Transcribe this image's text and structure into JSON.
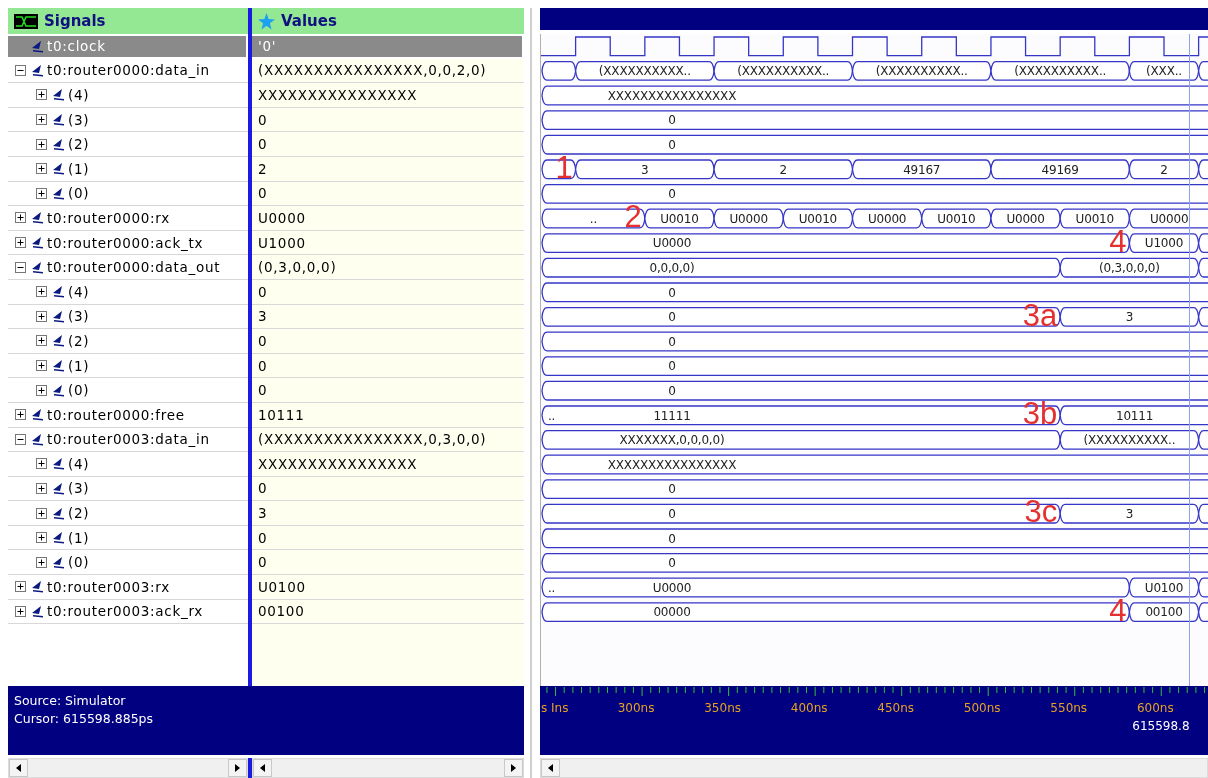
{
  "signals_header": {
    "title": "Signals"
  },
  "values_header": {
    "title": "Values"
  },
  "signals": [
    {
      "name": "t0:clock",
      "value": "'0'",
      "selected": true,
      "wave": {
        "kind": "clock"
      }
    },
    {
      "name": "t0:router0000:data_in",
      "value": "(XXXXXXXXXXXXXXXX,0,0,2,0)",
      "selected": false,
      "expanded": true,
      "wave": {
        "kind": "bus",
        "segments": [
          {
            "text": "(XXXXXXXXXX.."
          },
          {
            "text": "(XXXXXXXXXX.."
          },
          {
            "text": "(XXXXXXXXXX.."
          },
          {
            "text": "(XXXXXXXXXX.."
          },
          {
            "text": "(XXX.."
          }
        ]
      },
      "children": [
        {
          "name": "(4)",
          "value": "XXXXXXXXXXXXXXXX",
          "selected": false,
          "expanded": false,
          "wave": {
            "kind": "bus",
            "segments": [
              {
                "text": "XXXXXXXXXXXXXXXX"
              }
            ]
          }
        },
        {
          "name": "(3)",
          "value": "0",
          "selected": false,
          "expanded": false,
          "wave": {
            "kind": "bus",
            "segments": [
              {
                "text": "0"
              }
            ]
          }
        },
        {
          "name": "(2)",
          "value": "0",
          "selected": false,
          "expanded": false,
          "wave": {
            "kind": "bus",
            "segments": [
              {
                "text": "0"
              }
            ]
          }
        },
        {
          "name": "(1)",
          "value": "2",
          "selected": false,
          "expanded": false,
          "wave": {
            "kind": "bus",
            "segments": [
              {
                "text": "3",
                "marker": "1"
              },
              {
                "text": "2"
              },
              {
                "text": "49167"
              },
              {
                "text": "49169"
              },
              {
                "text": "2"
              }
            ]
          }
        },
        {
          "name": "(0)",
          "value": "0",
          "selected": false,
          "expanded": false,
          "wave": {
            "kind": "bus",
            "segments": [
              {
                "text": "0"
              }
            ]
          }
        }
      ]
    },
    {
      "name": "t0:router0000:rx",
      "value": "U0000",
      "selected": false,
      "expanded": false,
      "wave": {
        "kind": "bus",
        "segments": [
          {
            "text": ".."
          },
          {
            "text": "U0010",
            "marker": "2"
          },
          {
            "text": "U0000"
          },
          {
            "text": "U0010"
          },
          {
            "text": "U0000"
          },
          {
            "text": "U0010"
          },
          {
            "text": "U0000"
          },
          {
            "text": "U0010"
          },
          {
            "text": "U0000"
          }
        ]
      }
    },
    {
      "name": "t0:router0000:ack_tx",
      "value": "U1000",
      "selected": false,
      "expanded": false,
      "wave": {
        "kind": "bus",
        "segments": [
          {
            "text": "U0000"
          },
          {
            "text": "U1000",
            "marker": "4"
          }
        ]
      }
    },
    {
      "name": "t0:router0000:data_out",
      "value": "(0,3,0,0,0)",
      "selected": false,
      "expanded": true,
      "wave": {
        "kind": "bus",
        "segments": [
          {
            "text": "0,0,0,0)"
          },
          {
            "text": "(0,3,0,0,0)"
          }
        ]
      },
      "children": [
        {
          "name": "(4)",
          "value": "0",
          "selected": false,
          "expanded": false,
          "wave": {
            "kind": "bus",
            "segments": [
              {
                "text": "0"
              }
            ]
          }
        },
        {
          "name": "(3)",
          "value": "3",
          "selected": false,
          "expanded": false,
          "wave": {
            "kind": "bus",
            "segments": [
              {
                "text": "0"
              },
              {
                "text": "3",
                "marker": "3a"
              }
            ]
          }
        },
        {
          "name": "(2)",
          "value": "0",
          "selected": false,
          "expanded": false,
          "wave": {
            "kind": "bus",
            "segments": [
              {
                "text": "0"
              }
            ]
          }
        },
        {
          "name": "(1)",
          "value": "0",
          "selected": false,
          "expanded": false,
          "wave": {
            "kind": "bus",
            "segments": [
              {
                "text": "0"
              }
            ]
          }
        },
        {
          "name": "(0)",
          "value": "0",
          "selected": false,
          "expanded": false,
          "wave": {
            "kind": "bus",
            "segments": [
              {
                "text": "0"
              }
            ]
          }
        }
      ]
    },
    {
      "name": "t0:router0000:free",
      "value": "10111",
      "selected": false,
      "expanded": false,
      "wave": {
        "kind": "bus",
        "segments": [
          {
            "text": "11111",
            "lead": ".."
          },
          {
            "text": "10111",
            "marker": "3b"
          }
        ]
      }
    },
    {
      "name": "t0:router0003:data_in",
      "value": "(XXXXXXXXXXXXXXXX,0,3,0,0)",
      "selected": false,
      "expanded": true,
      "wave": {
        "kind": "bus",
        "segments": [
          {
            "text": "XXXXXXX,0,0,0,0)"
          },
          {
            "text": "(XXXXXXXXXX.."
          }
        ]
      },
      "children": [
        {
          "name": "(4)",
          "value": "XXXXXXXXXXXXXXXX",
          "selected": false,
          "expanded": false,
          "wave": {
            "kind": "bus",
            "segments": [
              {
                "text": "XXXXXXXXXXXXXXXX"
              }
            ]
          }
        },
        {
          "name": "(3)",
          "value": "0",
          "selected": false,
          "expanded": false,
          "wave": {
            "kind": "bus",
            "segments": [
              {
                "text": "0"
              }
            ]
          }
        },
        {
          "name": "(2)",
          "value": "3",
          "selected": false,
          "expanded": false,
          "wave": {
            "kind": "bus",
            "segments": [
              {
                "text": "0"
              },
              {
                "text": "3",
                "marker": "3c"
              }
            ]
          }
        },
        {
          "name": "(1)",
          "value": "0",
          "selected": false,
          "expanded": false,
          "wave": {
            "kind": "bus",
            "segments": [
              {
                "text": "0"
              }
            ]
          }
        },
        {
          "name": "(0)",
          "value": "0",
          "selected": false,
          "expanded": false,
          "wave": {
            "kind": "bus",
            "segments": [
              {
                "text": "0"
              }
            ]
          }
        }
      ]
    },
    {
      "name": "t0:router0003:rx",
      "value": "U0100",
      "selected": false,
      "expanded": false,
      "wave": {
        "kind": "bus",
        "segments": [
          {
            "text": "U0000",
            "lead": ".."
          },
          {
            "text": "U0100"
          }
        ]
      }
    },
    {
      "name": "t0:router0003:ack_rx",
      "value": "00100",
      "selected": false,
      "expanded": false,
      "wave": {
        "kind": "bus",
        "segments": [
          {
            "text": "00000"
          },
          {
            "text": "00100",
            "marker": "4"
          }
        ]
      }
    }
  ],
  "waveform": {
    "cursor_readout": "615598.8",
    "axis": {
      "fragment": "s Ins",
      "labels": [
        "300ns",
        "350ns",
        "400ns",
        "450ns",
        "500ns",
        "550ns",
        "600ns"
      ]
    }
  },
  "status": {
    "source": "Source: Simulator",
    "cursor": "Cursor: 615598.885ps"
  }
}
